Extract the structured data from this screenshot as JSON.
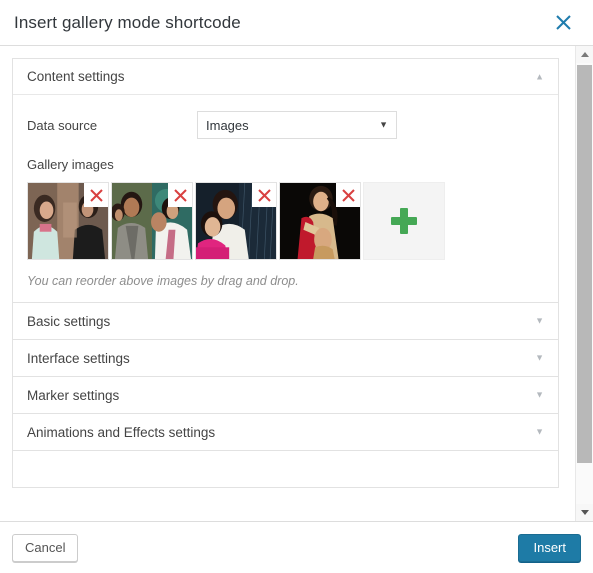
{
  "header": {
    "title": "Insert gallery mode shortcode",
    "close_icon": "close-icon",
    "close_color": "#1f7cad"
  },
  "content_panel": {
    "title": "Content settings",
    "arrow": "▲",
    "expanded": true,
    "data_source": {
      "label": "Data source",
      "value": "Images",
      "caret": "▼",
      "options": [
        "Images"
      ]
    },
    "gallery": {
      "label": "Gallery images",
      "remove_icon": "close-icon",
      "remove_color": "#d94040",
      "add_icon": "plus-icon",
      "add_color": "#45a855",
      "items": [
        {
          "alt": "gallery-thumbnail-1"
        },
        {
          "alt": "gallery-thumbnail-2"
        },
        {
          "alt": "gallery-thumbnail-3"
        },
        {
          "alt": "gallery-thumbnail-4"
        }
      ],
      "hint": "You can reorder above images by drag and drop."
    }
  },
  "collapsed_panels": [
    {
      "title": "Basic settings",
      "arrow": "▼"
    },
    {
      "title": "Interface settings",
      "arrow": "▼"
    },
    {
      "title": "Marker settings",
      "arrow": "▼"
    },
    {
      "title": "Animations and Effects settings",
      "arrow": "▼"
    }
  ],
  "footer": {
    "cancel_label": "Cancel",
    "insert_label": "Insert",
    "insert_color": "#1e7ba6"
  },
  "scrollbar": {
    "up_icon": "caret-up-icon",
    "down_icon": "caret-down-icon"
  }
}
